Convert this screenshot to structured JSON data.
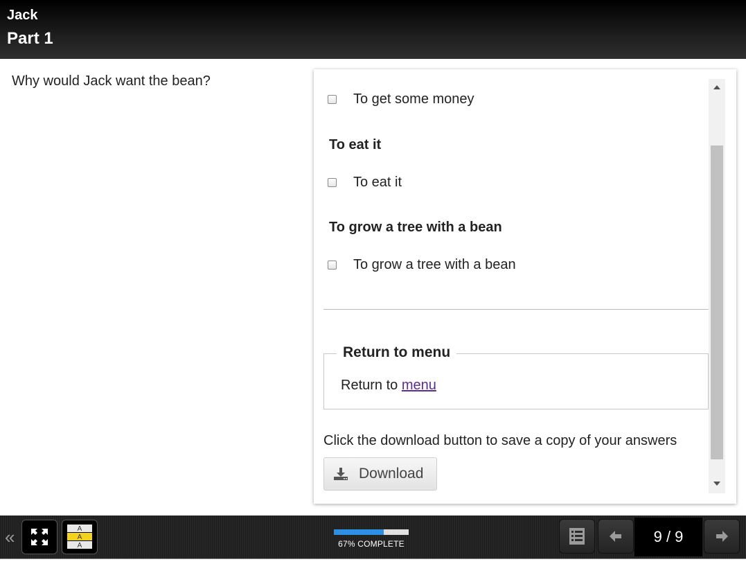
{
  "header": {
    "title": "Jack",
    "subtitle": "Part 1"
  },
  "question": {
    "text": "Why would Jack want the bean?"
  },
  "answers": {
    "options": [
      {
        "label": "To get some money",
        "checked": false
      },
      {
        "heading": "To eat it",
        "label": "To eat it",
        "checked": false
      },
      {
        "heading": "To grow a tree with a bean",
        "label": "To grow a tree with a bean",
        "checked": false
      }
    ]
  },
  "return_menu": {
    "legend": "Return to menu",
    "text_prefix": "Return to ",
    "link_text": "menu"
  },
  "download": {
    "info_text": "Click the download button to save a copy of your answers",
    "button_label": "Download",
    "icon": "download-icon"
  },
  "footer": {
    "collapse_icon": "«",
    "fullscreen_icon": "fullscreen-icon",
    "text_size_icon": "text-size-icon",
    "progress_fraction": 0.67,
    "progress_label": "67% COMPLETE",
    "menu_icon": "list-menu-icon",
    "page_counter": "9 / 9",
    "accent_color": "#2f8fe3"
  }
}
